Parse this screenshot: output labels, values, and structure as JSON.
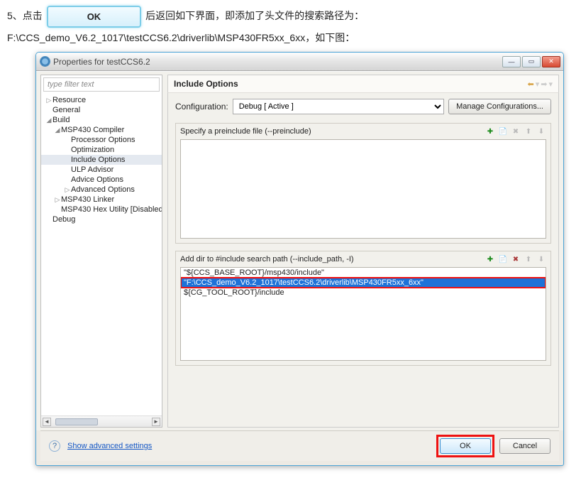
{
  "doc": {
    "step_prefix": "5、点击",
    "ok_pill": "OK",
    "step_suffix": "后返回如下界面，即添加了头文件的搜索路径为：",
    "path_line": "F:\\CCS_demo_V6.2_1017\\testCCS6.2\\driverlib\\MSP430FR5xx_6xx，如下图："
  },
  "dialog": {
    "title": "Properties for testCCS6.2",
    "filter_placeholder": "type filter text",
    "tree": {
      "resource": "Resource",
      "general": "General",
      "build": "Build",
      "compiler": "MSP430 Compiler",
      "proc": "Processor Options",
      "opt": "Optimization",
      "include": "Include Options",
      "ulp": "ULP Advisor",
      "advice": "Advice Options",
      "advanced": "Advanced Options",
      "linker": "MSP430 Linker",
      "hex": "MSP430 Hex Utility  [Disabled",
      "debug": "Debug"
    },
    "panel_title": "Include Options",
    "configuration_label": "Configuration:",
    "configuration_value": "Debug  [ Active ]",
    "manage_btn": "Manage Configurations...",
    "group_preinclude": "Specify a preinclude file (--preinclude)",
    "group_includepath": "Add dir to #include search path (--include_path, -I)",
    "paths": {
      "p0": "\"${CCS_BASE_ROOT}/msp430/include\"",
      "p1": "\"F:\\CCS_demo_V6.2_1017\\testCCS6.2\\driverlib\\MSP430FR5xx_6xx\"",
      "p2": "${CG_TOOL_ROOT}/include"
    },
    "help_link": "Show advanced settings",
    "ok": "OK",
    "cancel": "Cancel"
  }
}
